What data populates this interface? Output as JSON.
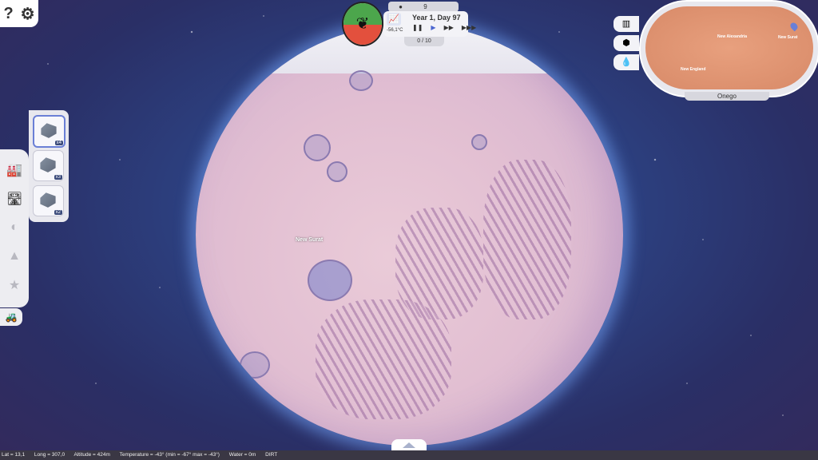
{
  "hud": {
    "population": "9",
    "date": "Year 1, Day 97",
    "temperature": "-56,1°C",
    "progress_count": "0 / 10",
    "play_symbol": "▶",
    "pause_symbol": "❚❚",
    "fast_symbol": "▶▶",
    "faster_symbol": "▶▶▶"
  },
  "corner": {
    "help": "?",
    "settings": "⚙"
  },
  "planet": {
    "city_label": "New Surat"
  },
  "units": [
    {
      "count": "x4"
    },
    {
      "count": "x3"
    },
    {
      "count": "x2"
    }
  ],
  "minimap": {
    "name": "Onego",
    "labels": [
      "New Alexandria",
      "New Surat",
      "New England"
    ]
  },
  "status": {
    "lat": "Lat = 13,1",
    "long": "Long = 307,0",
    "altitude": "Altitude = 424m",
    "temperature": "Temperature = -43° (min = -67° max = -43°)",
    "water": "Water = 0m",
    "soil": "DIRT"
  },
  "colors": {
    "accent": "#6a7fd6",
    "status_bg": "#3a3744",
    "emblem_green": "#4ca64c",
    "emblem_red": "#e3503d"
  }
}
